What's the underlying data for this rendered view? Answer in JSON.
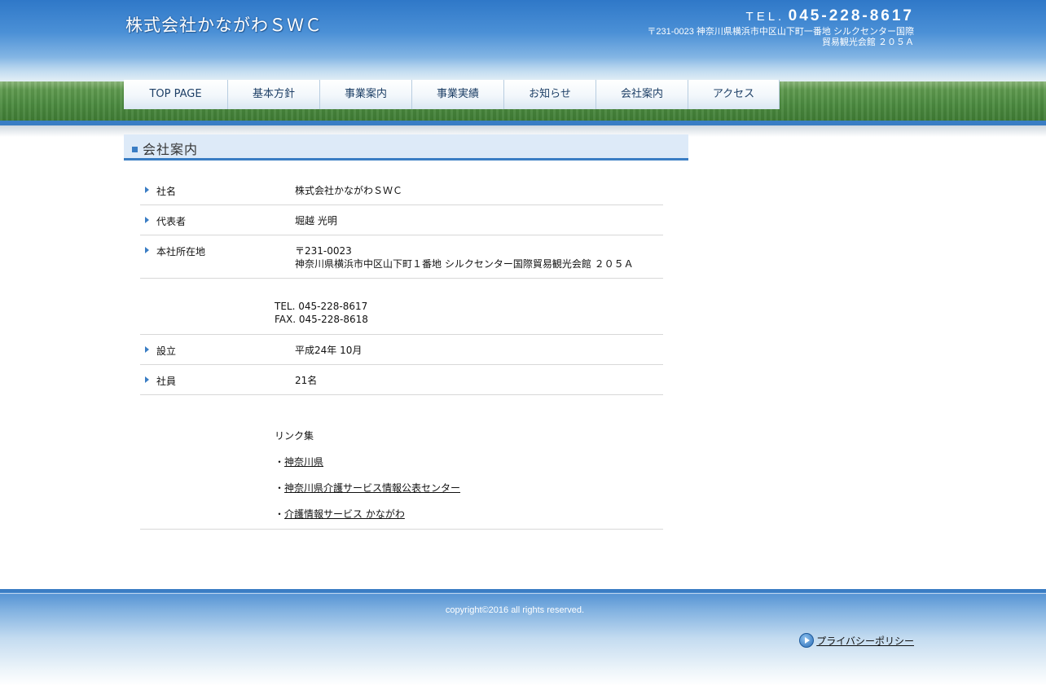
{
  "header": {
    "logo": "株式会社かながわＳＷＣ",
    "tel_label": "TEL.",
    "tel_number": "045-228-8617",
    "address_line1": "〒231-0023 神奈川県横浜市中区山下町一番地 シルクセンター国際",
    "address_line2": "貿易観光会館 ２０５Ａ"
  },
  "nav": {
    "items": [
      {
        "label": "TOP PAGE"
      },
      {
        "label": "基本方針"
      },
      {
        "label": "事業案内"
      },
      {
        "label": "事業実績"
      },
      {
        "label": "お知らせ"
      },
      {
        "label": "会社案内"
      },
      {
        "label": "アクセス"
      }
    ]
  },
  "main": {
    "title": "会社案内",
    "rows": [
      {
        "label": "社名",
        "value": "株式会社かながわＳＷＣ"
      },
      {
        "label": "代表者",
        "value": "堀越 光明"
      },
      {
        "label": "本社所在地",
        "value_line1": "〒231-0023",
        "value_line2": "神奈川県横浜市中区山下町１番地 シルクセンター国際貿易観光会館 ２０５Ａ"
      },
      {
        "tel": "TEL. 045-228-8617",
        "fax": "FAX. 045-228-8618"
      },
      {
        "label": "設立",
        "value": "平成24年 10月"
      },
      {
        "label": "社員",
        "value": "21名"
      }
    ],
    "links": {
      "heading": "リンク集",
      "bullet": "・",
      "items": [
        {
          "label": "神奈川県"
        },
        {
          "label": "神奈川県介護サービス情報公表センター"
        },
        {
          "label": "介護情報サービス かながわ"
        }
      ]
    }
  },
  "footer": {
    "copyright": "copyright©2016  all rights reserved.",
    "privacy_label": "プライバシーポリシー"
  },
  "colors": {
    "accent": "#3a7dc4",
    "title_bg": "#ddeaf8",
    "nav_text": "#1d3f66"
  }
}
